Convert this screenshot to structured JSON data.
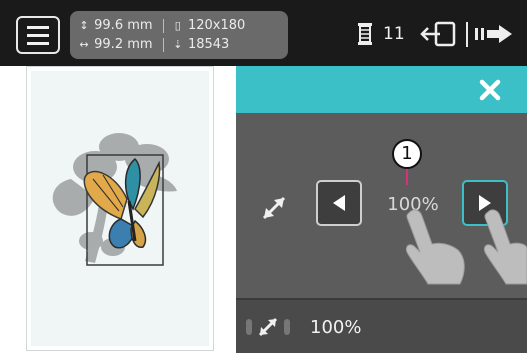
{
  "top_bar": {
    "height": "99.6 mm",
    "width": "99.2 mm",
    "hoop": "120x180",
    "stitches": "18543",
    "thread_changes": "11"
  },
  "scale_panel": {
    "callout_number": "1",
    "scale_value": "100%",
    "footer_scale": "100%"
  },
  "colors": {
    "accent": "#3cc0c7",
    "panel": "#565656",
    "topbar": "#1a1a1a"
  },
  "icons": [
    "menu-icon",
    "height-icon",
    "width-icon",
    "hoop-icon",
    "stitch-icon",
    "thread-spool-icon",
    "exit-icon",
    "next-icon",
    "close-icon",
    "expand-icon",
    "arrow-left-icon",
    "arrow-right-icon"
  ]
}
